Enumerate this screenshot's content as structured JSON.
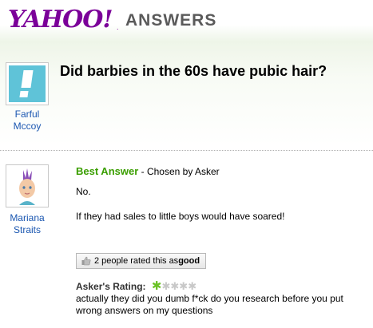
{
  "header": {
    "logo_yahoo": "YAHOO!",
    "logo_dot": ".",
    "logo_answers": "ANSWERS"
  },
  "question": {
    "title": "Did barbies in the 60s have pubic hair?",
    "asker": {
      "name_line1": "Farful",
      "name_line2": "Mccoy"
    }
  },
  "best_answer": {
    "label": "Best Answer",
    "separator": " - ",
    "chosen_by": "Chosen by Asker",
    "answerer": {
      "name_line1": "Mariana",
      "name_line2": "Straits"
    },
    "text_line1": "No.",
    "text_line2": "If they had sales to little boys would have soared!",
    "rating_button": {
      "prefix": "2 people rated this as ",
      "value": "good"
    },
    "askers_rating": {
      "label": "Asker's Rating:",
      "stars_filled": 1,
      "stars_total": 5,
      "comment": "actually they did you dumb f*ck do you research before you put wrong answers on my questions"
    }
  },
  "colors": {
    "brand_purple": "#7b0099",
    "link_blue": "#1b57b1",
    "best_green": "#3a9e00",
    "star_green": "#6cc228"
  }
}
